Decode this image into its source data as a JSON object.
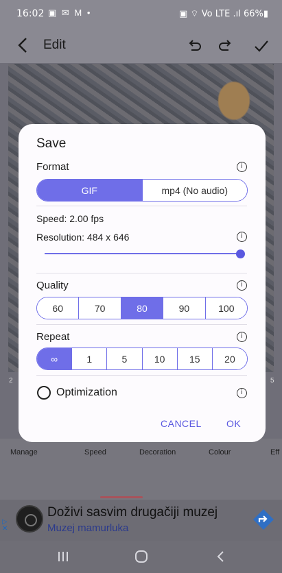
{
  "status_bar": {
    "time": "16:02",
    "left_icons": "▣ ✉ M •",
    "right": "▣ ⌔ Vo LTE .ıl 66%▮"
  },
  "app_bar": {
    "title": "Edit"
  },
  "strip_numbers": [
    "2",
    "5"
  ],
  "tools": [
    "Manage",
    "Speed",
    "Decoration",
    "Colour",
    "Eff"
  ],
  "dialog": {
    "title": "Save",
    "format": {
      "label": "Format",
      "options": [
        "GIF",
        "mp4 (No audio)"
      ],
      "selected": "GIF"
    },
    "speed": {
      "label": "Speed",
      "value": ": 2.00 fps"
    },
    "resolution": {
      "label": "Resolution",
      "value": ": 484 x 646",
      "slider_fraction": 1.0
    },
    "quality": {
      "label": "Quality",
      "options": [
        "60",
        "70",
        "80",
        "90",
        "100"
      ],
      "selected": "80"
    },
    "repeat": {
      "label": "Repeat",
      "options": [
        "∞",
        "1",
        "5",
        "10",
        "15",
        "20"
      ],
      "selected": "∞"
    },
    "optimization": {
      "label": "Optimization",
      "checked": false
    },
    "cancel_label": "CANCEL",
    "ok_label": "OK"
  },
  "ad": {
    "headline": "Doživi sasvim drugačiji muzej",
    "brand": "Muzej mamurluka"
  },
  "colors": {
    "accent": "#6f6ee8",
    "scrim": "#6f6e78"
  }
}
